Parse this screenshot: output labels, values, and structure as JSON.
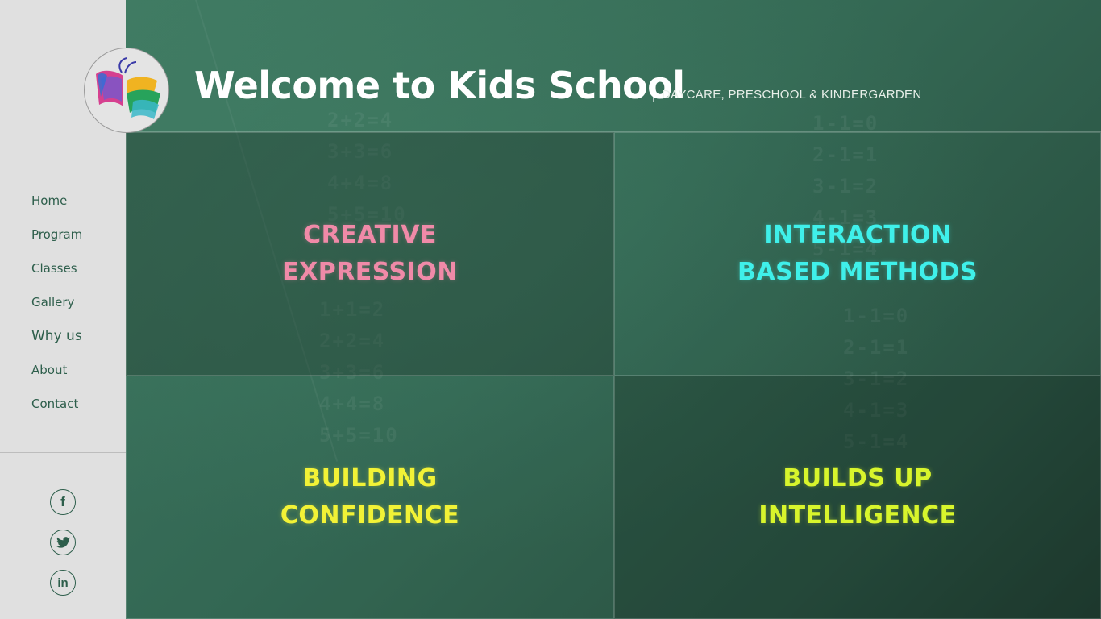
{
  "header": {
    "title": "Welcome to Kids School",
    "tagline": "DAYCARE, PRESCHOOL & KINDERGARDEN"
  },
  "nav": {
    "items": [
      {
        "label": "Home"
      },
      {
        "label": "Program"
      },
      {
        "label": "Classes"
      },
      {
        "label": "Gallery"
      },
      {
        "label": "Why us"
      },
      {
        "label": "About"
      },
      {
        "label": "Contact"
      }
    ]
  },
  "social": {
    "facebook": "f",
    "twitter": "twitter-bird",
    "linkedin": "in"
  },
  "tiles": [
    {
      "label": "CREATIVE\nEXPRESSION",
      "color": "#f08aa8"
    },
    {
      "label": "INTERACTION\nBASED METHODS",
      "color": "#3ff0ea"
    },
    {
      "label": "BUILDING\nCONFIDENCE",
      "color": "#f2f236"
    },
    {
      "label": "BUILDS UP\nINTELLIGENCE",
      "color": "#d8f52c"
    }
  ],
  "chalk": {
    "left_top": "2+2=4\n3+3=6\n4+4=8\n5+5=10",
    "left_bottom": "1+1=2\n2+2=4\n3+3=6\n4+4=8\n5+5=10",
    "right_top": "1-1=0\n2-1=1\n3-1=2\n4-1=3\n5-1=4",
    "right_bottom": "1-1=0\n2-1=1\n3-1=2\n4-1=3\n5-1=4"
  },
  "colors": {
    "board": "#356a55",
    "sidebar": "#e0e0e0",
    "nav_text": "#2d5e4b"
  }
}
